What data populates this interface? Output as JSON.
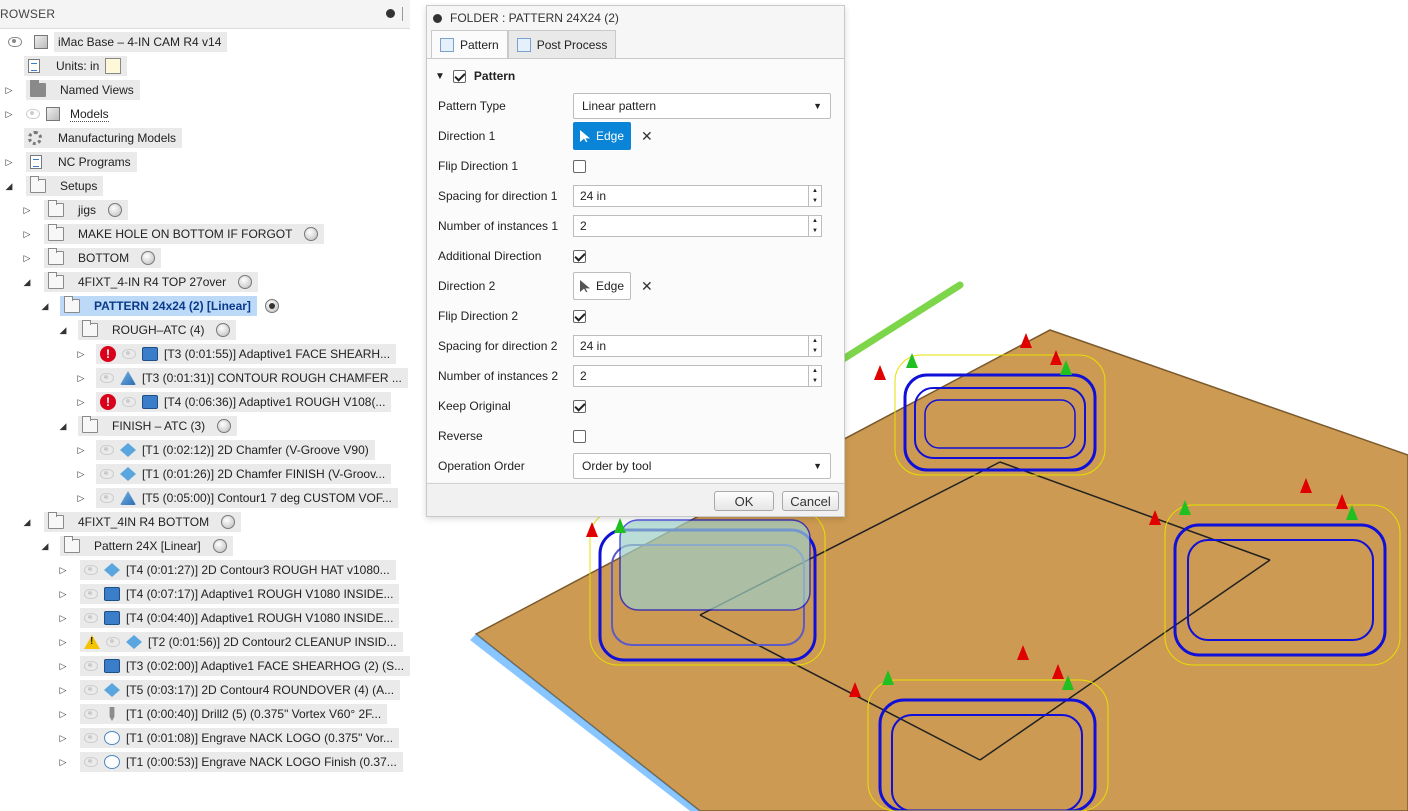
{
  "browser": {
    "title": "ROWSER",
    "root": "iMac Base – 4-IN CAM R4 v14",
    "units_label": "Units: in",
    "items": [
      {
        "label": "Named Views"
      },
      {
        "label": "Models"
      },
      {
        "label": "Manufacturing Models"
      },
      {
        "label": "NC Programs"
      },
      {
        "label": "Setups"
      }
    ],
    "setups": [
      {
        "label": "jigs"
      },
      {
        "label": "MAKE HOLE ON BOTTOM IF FORGOT"
      },
      {
        "label": "BOTTOM"
      },
      {
        "label": "4FIXT_4-IN R4 TOP 27over"
      }
    ],
    "pattern_selected": "PATTERN 24x24 (2) [Linear]",
    "rough_folder": "ROUGH–ATC (4)",
    "rough_ops": [
      {
        "label": "[T3 (0:01:55)] Adaptive1 FACE SHEARH..."
      },
      {
        "label": "[T3 (0:01:31)] CONTOUR ROUGH CHAMFER ..."
      },
      {
        "label": "[T4 (0:06:36)] Adaptive1 ROUGH V108(..."
      }
    ],
    "finish_folder": "FINISH – ATC (3)",
    "finish_ops": [
      {
        "label": "[T1 (0:02:12)] 2D Chamfer (V-Groove V90)"
      },
      {
        "label": "[T1 (0:01:26)] 2D Chamfer FINISH (V-Groov..."
      },
      {
        "label": "[T5 (0:05:00)] Contour1 7 deg CUSTOM VOF..."
      }
    ],
    "bottom_setup": "4FIXT_4IN R4 BOTTOM",
    "pattern2": "Pattern 24X [Linear]",
    "pattern2_ops": [
      {
        "label": "[T4 (0:01:27)] 2D Contour3 ROUGH HAT v1080..."
      },
      {
        "label": "[T4 (0:07:17)] Adaptive1 ROUGH V1080 INSIDE..."
      },
      {
        "label": "[T4 (0:04:40)] Adaptive1 ROUGH V1080 INSIDE..."
      },
      {
        "label": "[T2 (0:01:56)] 2D Contour2 CLEANUP INSID..."
      },
      {
        "label": "[T3 (0:02:00)] Adaptive1 FACE SHEARHOG (2) (S..."
      },
      {
        "label": "[T5 (0:03:17)] 2D Contour4 ROUNDOVER (4) (A..."
      },
      {
        "label": "[T1 (0:00:40)] Drill2 (5) (0.375\" Vortex V60° 2F..."
      },
      {
        "label": "[T1 (0:01:08)] Engrave NACK LOGO (0.375\" Vor..."
      },
      {
        "label": "[T1 (0:00:53)] Engrave NACK LOGO Finish (0.37..."
      }
    ]
  },
  "dialog": {
    "title": "FOLDER : PATTERN 24X24 (2)",
    "tabs": [
      "Pattern",
      "Post Process"
    ],
    "section": "Pattern",
    "fields": {
      "pattern_type_label": "Pattern Type",
      "pattern_type_value": "Linear pattern",
      "direction1_label": "Direction 1",
      "direction1_value": "Edge",
      "flip1_label": "Flip Direction 1",
      "spacing1_label": "Spacing for direction 1",
      "spacing1_value": "24 in",
      "instances1_label": "Number of instances 1",
      "instances1_value": "2",
      "additional_label": "Additional Direction",
      "direction2_label": "Direction 2",
      "direction2_value": "Edge",
      "flip2_label": "Flip Direction 2",
      "spacing2_label": "Spacing for direction 2",
      "spacing2_value": "24 in",
      "instances2_label": "Number of instances 2",
      "instances2_value": "2",
      "keep_label": "Keep Original",
      "reverse_label": "Reverse",
      "order_label": "Operation Order",
      "order_value": "Order by tool"
    },
    "ok": "OK",
    "cancel": "Cancel"
  },
  "colors": {
    "selection": "#bcd9f7",
    "active_blue": "#0a84d6",
    "stock": "#cc9a52",
    "toolpath": "#1010d8",
    "arrow": "#7dd64a"
  }
}
